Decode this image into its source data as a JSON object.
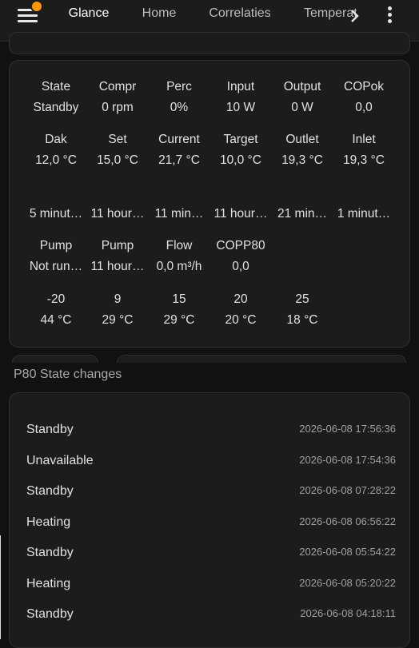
{
  "tabs": [
    "Glance",
    "Home",
    "Correlaties",
    "Temperatuur"
  ],
  "glance": {
    "rows": [
      [
        "State",
        "Compr",
        "Perc",
        "Input",
        "Output",
        "COPok"
      ],
      [
        "Standby",
        "0 rpm",
        "0%",
        "10 W",
        "0 W",
        "0,0"
      ],
      [
        "Dak",
        "Set",
        "Current",
        "Target",
        "Outlet",
        "Inlet"
      ],
      [
        "12,0 °C",
        "15,0 °C",
        "21,7 °C",
        "10,0 °C",
        "19,3 °C",
        "19,3 °C"
      ],
      [
        "5 minut…",
        "11 hour…",
        "11 min…",
        "11 hour…",
        "21 min…",
        "1 minut…"
      ],
      [
        "Pump",
        "Pump",
        "Flow",
        "COPP80"
      ],
      [
        "Not run…",
        "11 hour…",
        "0,0 m³/h",
        "0,0"
      ],
      [
        "-20",
        "9",
        "15",
        "20",
        "25"
      ],
      [
        "44 °C",
        "29 °C",
        "29 °C",
        "20 °C",
        "18 °C"
      ]
    ]
  },
  "state_changes": {
    "title": "P80 State changes",
    "rows": [
      {
        "state": "Standby",
        "time": "2026-06-08 17:56:36"
      },
      {
        "state": "Unavailable",
        "time": "2026-06-08 17:54:36"
      },
      {
        "state": "Standby",
        "time": "2026-06-08 07:28:22"
      },
      {
        "state": "Heating",
        "time": "2026-06-08 06:56:22"
      },
      {
        "state": "Standby",
        "time": "2026-06-08 05:54:22"
      },
      {
        "state": "Heating",
        "time": "2026-06-08 05:20:22"
      },
      {
        "state": "Standby",
        "time": "2026-06-08 04:18:11"
      }
    ]
  },
  "colors": {
    "accent_dot": "#ff9800",
    "background": "#111111",
    "card": "#1c1c1c"
  },
  "icons": {
    "menu": "hamburger-menu-icon",
    "scroll": "chevron-right-icon",
    "more": "kebab-menu-icon"
  }
}
